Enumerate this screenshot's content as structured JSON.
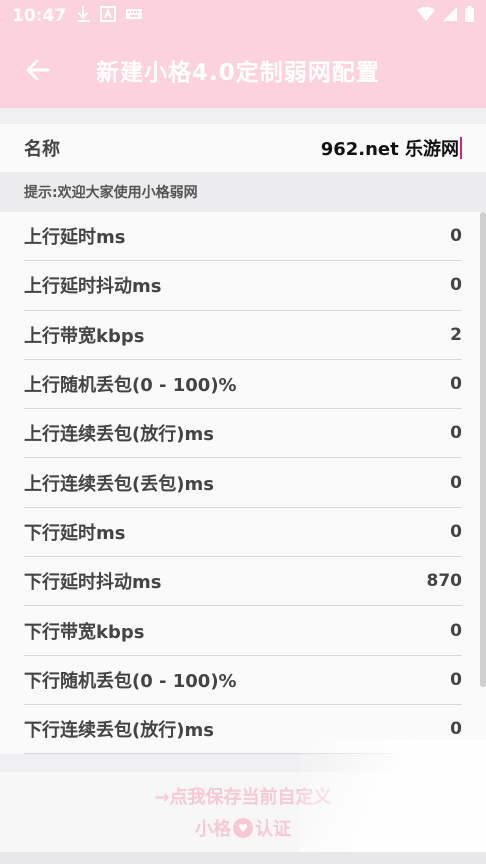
{
  "status_bar": {
    "time": "10:47",
    "icons": [
      "download-icon",
      "a-box-icon",
      "keyboard-icon",
      "wifi-icon",
      "signal-icon",
      "battery-icon"
    ]
  },
  "app_bar": {
    "title": "新建小格4.0定制弱网配置",
    "back_icon": "arrow-left-icon"
  },
  "name_field": {
    "label": "名称",
    "value": "962.net 乐游网"
  },
  "hint": "提示:欢迎大家使用小格弱网",
  "items": [
    {
      "label": "上行延时ms",
      "value": "0"
    },
    {
      "label": "上行延时抖动ms",
      "value": "0"
    },
    {
      "label": "上行带宽kbps",
      "value": "2"
    },
    {
      "label": "上行随机丢包(0 - 100)%",
      "value": "0"
    },
    {
      "label": "上行连续丢包(放行)ms",
      "value": "0"
    },
    {
      "label": "上行连续丢包(丢包)ms",
      "value": "0"
    },
    {
      "label": "下行延时ms",
      "value": "0"
    },
    {
      "label": "下行延时抖动ms",
      "value": "870"
    },
    {
      "label": "下行带宽kbps",
      "value": "0"
    },
    {
      "label": "下行随机丢包(0 - 100)%",
      "value": "0"
    },
    {
      "label": "下行连续丢包(放行)ms",
      "value": "0"
    }
  ],
  "save": {
    "line1": "→点我保存当前自定义",
    "line2_a": "小格",
    "line2_b": "认证"
  },
  "colors": {
    "header_bg": "#fcd3dc",
    "save_text": "#f6c9d5",
    "caret": "#e0245e"
  }
}
